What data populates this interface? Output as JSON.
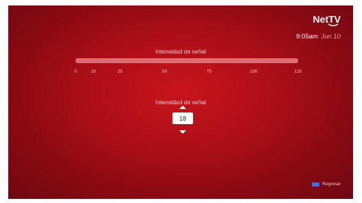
{
  "brand": {
    "logo_text": "Net",
    "logo_suffix": "TV"
  },
  "status": {
    "time": "9:05am",
    "date": "Jun 10"
  },
  "signal_meter": {
    "title": "Intensidad de señal",
    "scale": [
      "0",
      "10",
      "25",
      "50",
      "75",
      "100",
      "125"
    ],
    "scale_max": 125,
    "current_value": 0
  },
  "stepper": {
    "label": "Intensidad de señal",
    "value": "18"
  },
  "footer": {
    "back_label": "Regresar",
    "back_key_color": "#3a6ff0"
  },
  "colors": {
    "background_center": "#c8141c",
    "background_edge": "#6e0810",
    "bar": "#d96b72"
  }
}
